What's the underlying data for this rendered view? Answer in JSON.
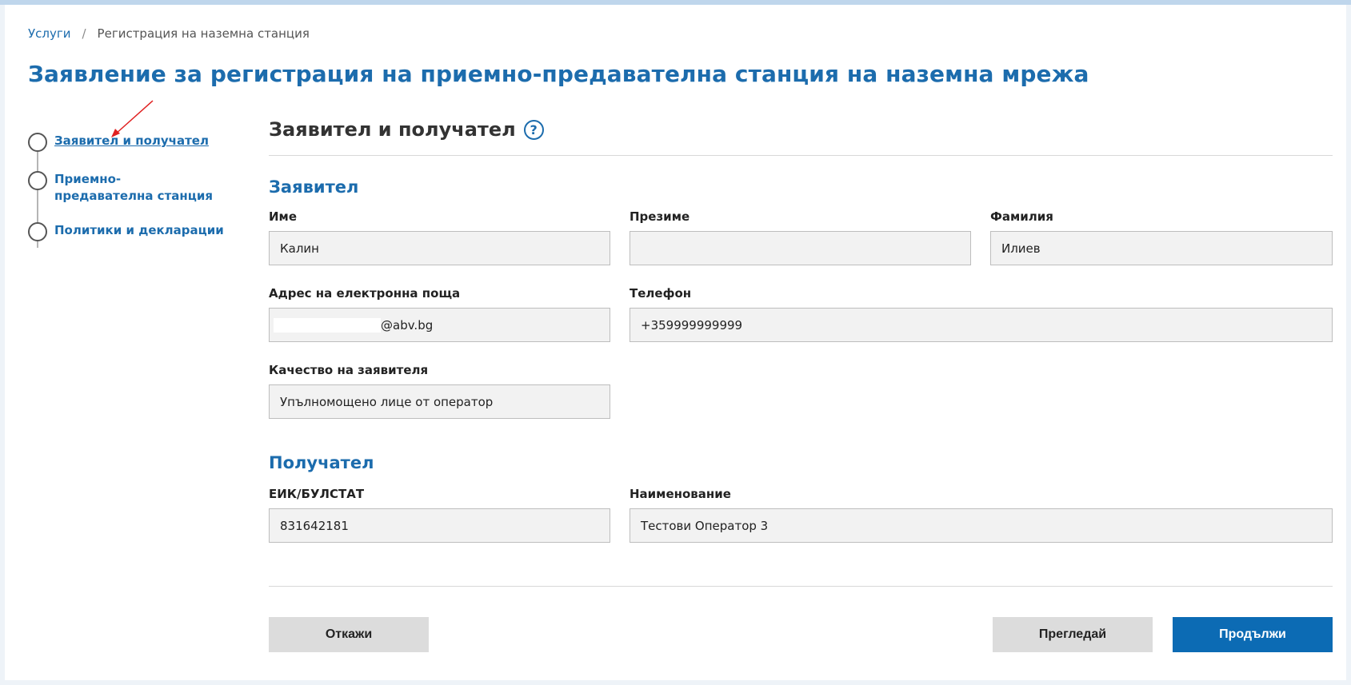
{
  "breadcrumb": {
    "root": "Услуги",
    "separator": "/",
    "current": "Регистрация на наземна станция"
  },
  "page_title": "Заявление за регистрация на приемно-предавателна станция на наземна мрежа",
  "stepper": {
    "steps": [
      {
        "label": "Заявител и получател"
      },
      {
        "label": "Приемно-предавателна станция"
      },
      {
        "label": "Политики и декларации"
      }
    ]
  },
  "section": {
    "title": "Заявител и получател",
    "help_symbol": "?"
  },
  "applicant": {
    "title": "Заявител",
    "first_name_label": "Име",
    "first_name_value": "Калин",
    "middle_name_label": "Презиме",
    "middle_name_value": "",
    "last_name_label": "Фамилия",
    "last_name_value": "Илиев",
    "email_label": "Адрес на електронна поща",
    "email_value": "@abv.bg",
    "phone_label": "Телефон",
    "phone_value": "+359999999999",
    "capacity_label": "Качество на заявителя",
    "capacity_value": "Упълномощено лице от оператор"
  },
  "recipient": {
    "title": "Получател",
    "eik_label": "ЕИК/БУЛСТАТ",
    "eik_value": "831642181",
    "name_label": "Наименование",
    "name_value": "Тестови Оператор 3"
  },
  "actions": {
    "cancel": "Откажи",
    "review": "Прегледай",
    "continue": "Продължи"
  },
  "colors": {
    "accent": "#1c6cad",
    "primary_button": "#0c6bb4",
    "annotation_arrow": "#e02020"
  }
}
